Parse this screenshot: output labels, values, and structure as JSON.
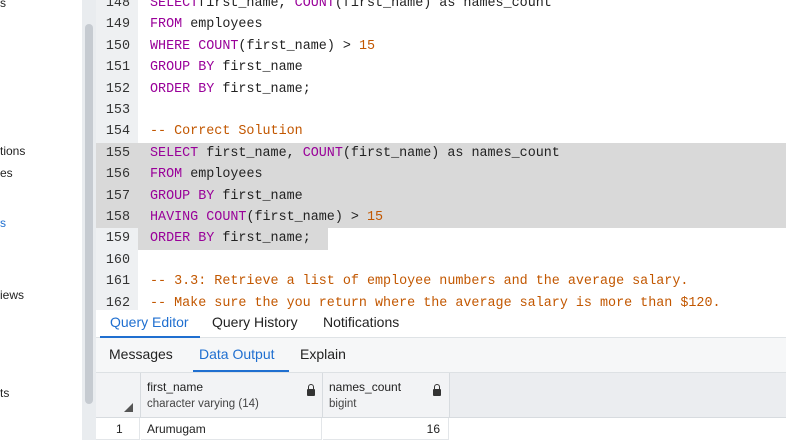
{
  "browser_panel": {
    "fragments": [
      "s",
      "tions",
      "es",
      "s",
      "iews",
      "ts"
    ]
  },
  "editor": {
    "lines": [
      {
        "n": "148",
        "tokens": [
          [
            "kw",
            "SELECT"
          ],
          [
            "",
            "first_name, "
          ],
          [
            "kw",
            "COUNT"
          ],
          [
            "",
            "(first_name) as names_count"
          ]
        ]
      },
      {
        "n": "149",
        "tokens": [
          [
            "kw",
            "FROM"
          ],
          [
            "",
            " employees"
          ]
        ]
      },
      {
        "n": "150",
        "tokens": [
          [
            "kw",
            "WHERE"
          ],
          [
            "",
            " "
          ],
          [
            "kw",
            "COUNT"
          ],
          [
            "",
            "(first_name) > "
          ],
          [
            "num",
            "15"
          ]
        ]
      },
      {
        "n": "151",
        "tokens": [
          [
            "kw",
            "GROUP BY"
          ],
          [
            "",
            " first_name"
          ]
        ]
      },
      {
        "n": "152",
        "tokens": [
          [
            "kw",
            "ORDER BY"
          ],
          [
            "",
            " first_name;"
          ]
        ]
      },
      {
        "n": "153",
        "tokens": []
      },
      {
        "n": "154",
        "tokens": [
          [
            "cmt",
            "-- Correct Solution"
          ]
        ]
      },
      {
        "n": "155",
        "tokens": [
          [
            "kw",
            "SELECT"
          ],
          [
            "",
            " first_name, "
          ],
          [
            "kw",
            "COUNT"
          ],
          [
            "",
            "(first_name) as names_count"
          ]
        ],
        "sel": true
      },
      {
        "n": "156",
        "tokens": [
          [
            "kw",
            "FROM"
          ],
          [
            "",
            " employees"
          ]
        ],
        "sel": true
      },
      {
        "n": "157",
        "tokens": [
          [
            "kw",
            "GROUP BY"
          ],
          [
            "",
            " first_name"
          ]
        ],
        "sel": true
      },
      {
        "n": "158",
        "tokens": [
          [
            "kw",
            "HAVING COUNT"
          ],
          [
            "",
            "(first_name) > "
          ],
          [
            "num",
            "15"
          ]
        ],
        "sel": true
      },
      {
        "n": "159",
        "tokens": [
          [
            "kw",
            "ORDER BY"
          ],
          [
            "",
            " first_name;"
          ]
        ],
        "selpartial": true
      },
      {
        "n": "160",
        "tokens": []
      },
      {
        "n": "161",
        "tokens": [
          [
            "cmt",
            "-- 3.3: Retrieve a list of employee numbers and the average salary."
          ]
        ]
      },
      {
        "n": "162",
        "tokens": [
          [
            "cmt",
            "-- Make sure the you return where the average salary is more than $120."
          ]
        ]
      }
    ]
  },
  "tabs_top": [
    {
      "label": "Query Editor",
      "active": true
    },
    {
      "label": "Query History",
      "active": false
    },
    {
      "label": "Notifications",
      "active": false
    }
  ],
  "tabs_output": [
    {
      "label": "Messages",
      "active": false
    },
    {
      "label": "Data Output",
      "active": true
    },
    {
      "label": "Explain",
      "active": false
    }
  ],
  "grid": {
    "columns": [
      {
        "name": "first_name",
        "type": "character varying (14)"
      },
      {
        "name": "names_count",
        "type": "bigint"
      }
    ],
    "rows": [
      {
        "num": "1",
        "cells": [
          "Arumugam",
          "16"
        ]
      }
    ]
  },
  "colors": {
    "keyword": "#990099",
    "comment": "#c25700",
    "accent": "#1f6fd0",
    "selection": "#d9d9d9"
  }
}
